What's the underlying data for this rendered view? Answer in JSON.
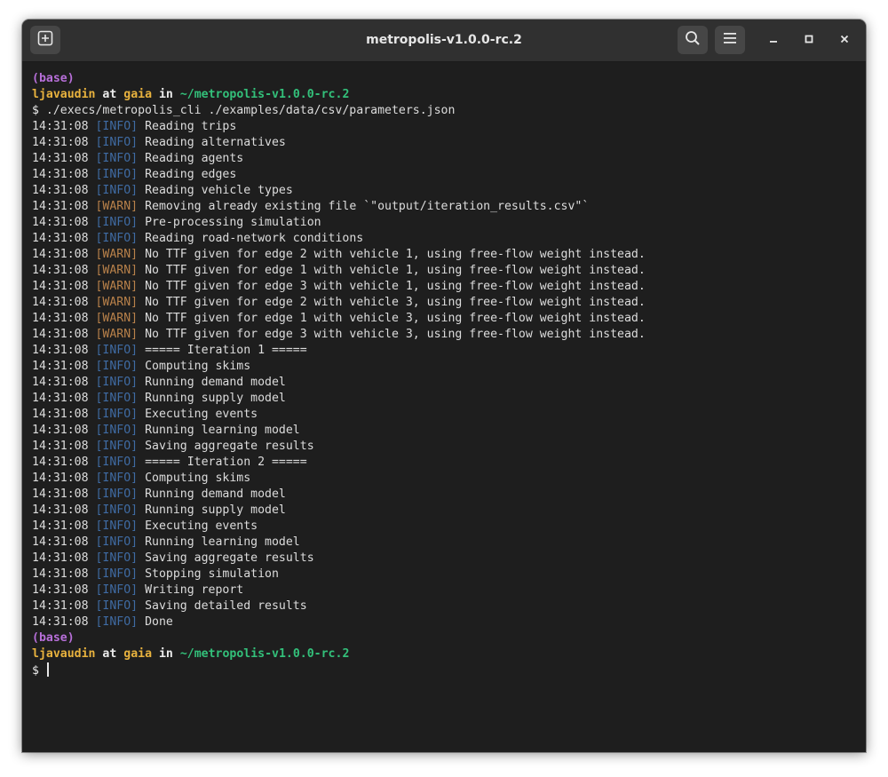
{
  "window": {
    "title": "metropolis-v1.0.0-rc.2"
  },
  "icons": {
    "new_tab": "new-tab-icon",
    "search": "search-icon",
    "menu": "hamburger-menu-icon",
    "minimize": "minimize-icon",
    "maximize": "maximize-icon",
    "close": "close-icon"
  },
  "colors": {
    "background": "#1e1e1e",
    "titlebar": "#303030",
    "conda_env": "#b76fd9",
    "user_host": "#e8b23e",
    "path": "#33c07a",
    "info": "#3f6ba3",
    "warn": "#b8814a"
  },
  "prompt1": {
    "env": "(base)",
    "user": "ljavaudin",
    "at": "at",
    "host": "gaia",
    "in": "in",
    "path": "~/metropolis-v1.0.0-rc.2",
    "symbol": "$",
    "command": "./execs/metropolis_cli ./examples/data/csv/parameters.json"
  },
  "log": [
    {
      "time": "14:31:08",
      "level": "[INFO]",
      "msg": "Reading trips"
    },
    {
      "time": "14:31:08",
      "level": "[INFO]",
      "msg": "Reading alternatives"
    },
    {
      "time": "14:31:08",
      "level": "[INFO]",
      "msg": "Reading agents"
    },
    {
      "time": "14:31:08",
      "level": "[INFO]",
      "msg": "Reading edges"
    },
    {
      "time": "14:31:08",
      "level": "[INFO]",
      "msg": "Reading vehicle types"
    },
    {
      "time": "14:31:08",
      "level": "[WARN]",
      "msg": "Removing already existing file `\"output/iteration_results.csv\"`"
    },
    {
      "time": "14:31:08",
      "level": "[INFO]",
      "msg": "Pre-processing simulation"
    },
    {
      "time": "14:31:08",
      "level": "[INFO]",
      "msg": "Reading road-network conditions"
    },
    {
      "time": "14:31:08",
      "level": "[WARN]",
      "msg": "No TTF given for edge 2 with vehicle 1, using free-flow weight instead."
    },
    {
      "time": "14:31:08",
      "level": "[WARN]",
      "msg": "No TTF given for edge 1 with vehicle 1, using free-flow weight instead."
    },
    {
      "time": "14:31:08",
      "level": "[WARN]",
      "msg": "No TTF given for edge 3 with vehicle 1, using free-flow weight instead."
    },
    {
      "time": "14:31:08",
      "level": "[WARN]",
      "msg": "No TTF given for edge 2 with vehicle 3, using free-flow weight instead."
    },
    {
      "time": "14:31:08",
      "level": "[WARN]",
      "msg": "No TTF given for edge 1 with vehicle 3, using free-flow weight instead."
    },
    {
      "time": "14:31:08",
      "level": "[WARN]",
      "msg": "No TTF given for edge 3 with vehicle 3, using free-flow weight instead."
    },
    {
      "time": "14:31:08",
      "level": "[INFO]",
      "msg": "===== Iteration 1 ====="
    },
    {
      "time": "14:31:08",
      "level": "[INFO]",
      "msg": "Computing skims"
    },
    {
      "time": "14:31:08",
      "level": "[INFO]",
      "msg": "Running demand model"
    },
    {
      "time": "14:31:08",
      "level": "[INFO]",
      "msg": "Running supply model"
    },
    {
      "time": "14:31:08",
      "level": "[INFO]",
      "msg": "Executing events"
    },
    {
      "time": "14:31:08",
      "level": "[INFO]",
      "msg": "Running learning model"
    },
    {
      "time": "14:31:08",
      "level": "[INFO]",
      "msg": "Saving aggregate results"
    },
    {
      "time": "14:31:08",
      "level": "[INFO]",
      "msg": "===== Iteration 2 ====="
    },
    {
      "time": "14:31:08",
      "level": "[INFO]",
      "msg": "Computing skims"
    },
    {
      "time": "14:31:08",
      "level": "[INFO]",
      "msg": "Running demand model"
    },
    {
      "time": "14:31:08",
      "level": "[INFO]",
      "msg": "Running supply model"
    },
    {
      "time": "14:31:08",
      "level": "[INFO]",
      "msg": "Executing events"
    },
    {
      "time": "14:31:08",
      "level": "[INFO]",
      "msg": "Running learning model"
    },
    {
      "time": "14:31:08",
      "level": "[INFO]",
      "msg": "Saving aggregate results"
    },
    {
      "time": "14:31:08",
      "level": "[INFO]",
      "msg": "Stopping simulation"
    },
    {
      "time": "14:31:08",
      "level": "[INFO]",
      "msg": "Writing report"
    },
    {
      "time": "14:31:08",
      "level": "[INFO]",
      "msg": "Saving detailed results"
    },
    {
      "time": "14:31:08",
      "level": "[INFO]",
      "msg": "Done"
    }
  ],
  "prompt2": {
    "env": "(base)",
    "user": "ljavaudin",
    "at": "at",
    "host": "gaia",
    "in": "in",
    "path": "~/metropolis-v1.0.0-rc.2",
    "symbol": "$"
  }
}
